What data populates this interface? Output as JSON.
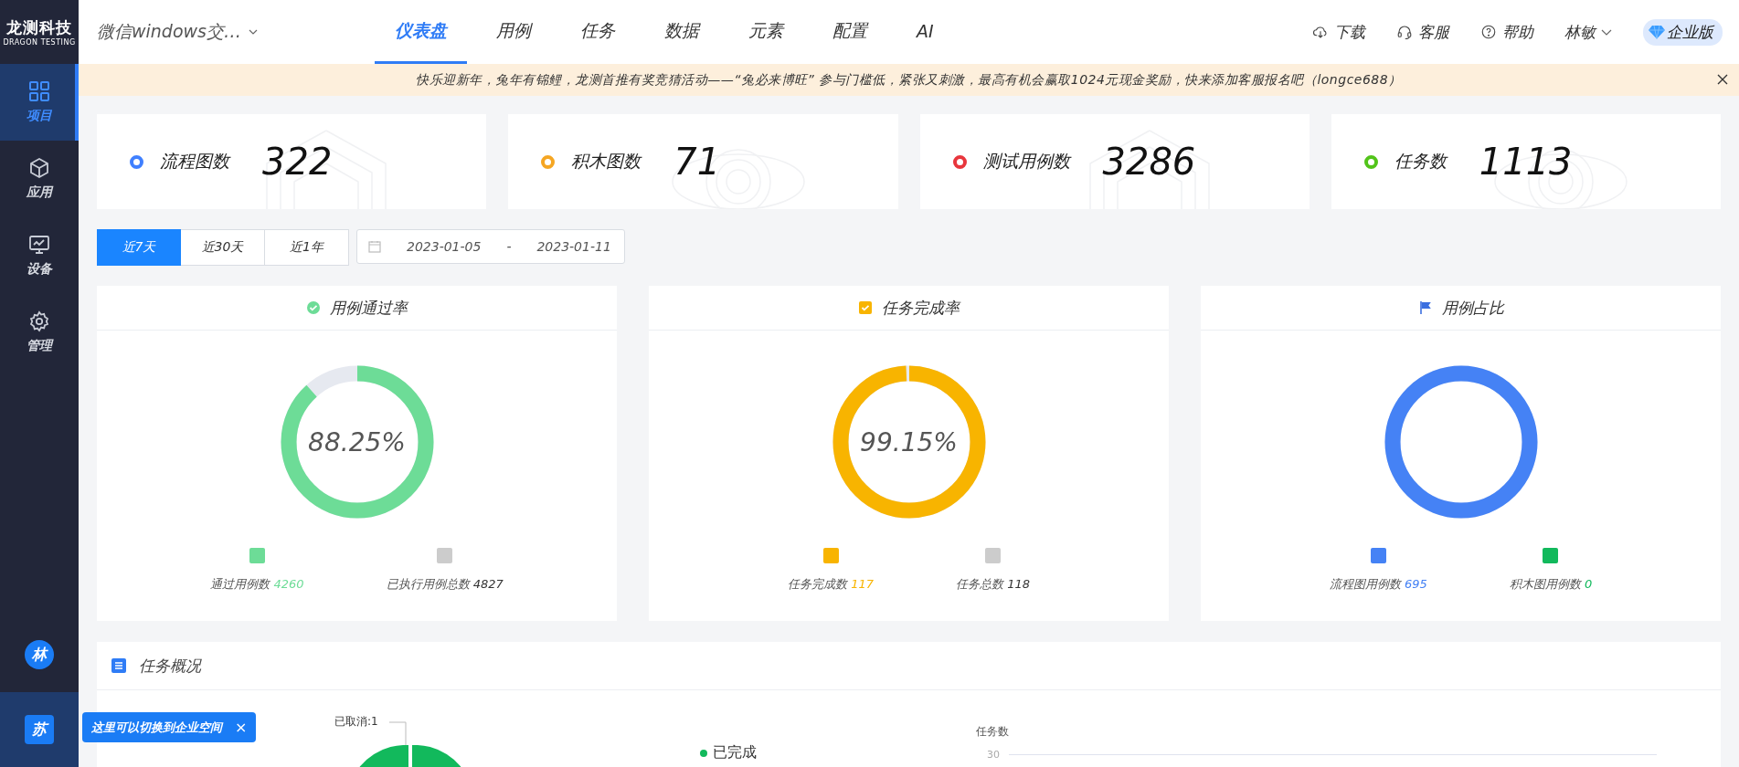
{
  "sidebar": {
    "logo": {
      "title": "龙测科技",
      "subtitle": "DRAGON TESTING"
    },
    "items": [
      {
        "kind": "grid",
        "label": "项目",
        "selected": true
      },
      {
        "kind": "cube",
        "label": "应用",
        "selected": false
      },
      {
        "kind": "monitor",
        "label": "设备",
        "selected": false
      },
      {
        "kind": "gear",
        "label": "管理",
        "selected": false
      }
    ],
    "avatars": [
      {
        "letter": "林",
        "selected": false
      },
      {
        "letter": "苏",
        "selected": true
      }
    ],
    "tooltip": {
      "text": "这里可以切换到企业空间",
      "close": "×"
    }
  },
  "topbar": {
    "project": "微信windows交…",
    "tabs": [
      {
        "label": "仪表盘",
        "selected": true
      },
      {
        "label": "用例",
        "selected": false
      },
      {
        "label": "任务",
        "selected": false
      },
      {
        "label": "数据",
        "selected": false
      },
      {
        "label": "元素",
        "selected": false
      },
      {
        "label": "配置",
        "selected": false
      },
      {
        "label": "AI",
        "selected": false
      }
    ],
    "actions": [
      {
        "kind": "download",
        "label": "下载"
      },
      {
        "kind": "headset",
        "label": "客服"
      },
      {
        "kind": "help",
        "label": "帮助"
      }
    ],
    "user": "林敏",
    "edition": "企业版"
  },
  "banner": {
    "text": "快乐迎新年，兔年有锦鲤，龙测首推有奖竞猜活动——“兔必来博旺” 参与门槛低，紧张又刺激，最高有机会赢取1024元现金奖励，快来添加客服报名吧（longce688）"
  },
  "stats": [
    {
      "label": "流程图数",
      "value": "322",
      "color": "#4080ff"
    },
    {
      "label": "积木图数",
      "value": "71",
      "color": "#f5a623"
    },
    {
      "label": "测试用例数",
      "value": "3286",
      "color": "#e8363d"
    },
    {
      "label": "任务数",
      "value": "1113",
      "color": "#52c41a"
    }
  ],
  "range": {
    "options": [
      {
        "label": "近7天",
        "selected": true
      },
      {
        "label": "近30天",
        "selected": false
      },
      {
        "label": "近1年",
        "selected": false
      }
    ],
    "start": "2023-01-05",
    "separator": "-",
    "end": "2023-01-11"
  },
  "rate_cards": [
    {
      "kind": "check",
      "title": "用例通过率",
      "center": "88.25%",
      "level": 0.8825,
      "color": "#6ddc97",
      "legend": [
        {
          "label": "通过用例数",
          "value": "4260",
          "color": "#6ddc97"
        },
        {
          "label": "已执行用例总数",
          "value": "4827",
          "color": "#cccccc"
        }
      ]
    },
    {
      "kind": "checkbox",
      "title": "任务完成率",
      "center": "99.15%",
      "level": 0.9915,
      "color": "#f8b400",
      "legend": [
        {
          "label": "任务完成数",
          "value": "117",
          "color": "#f8b400"
        },
        {
          "label": "任务总数",
          "value": "118",
          "color": "#cccccc"
        }
      ]
    },
    {
      "kind": "flag",
      "title": "用例占比",
      "level": 1,
      "color": "#4582f5",
      "legend": [
        {
          "label": "流程图用例数",
          "value": "695",
          "color": "#4582f5"
        },
        {
          "label": "积木图用例数",
          "value": "0",
          "color": "#12b95c"
        }
      ]
    }
  ],
  "overview": {
    "title": "任务概况",
    "pie_label": "已取消:1",
    "legend": [
      {
        "label": "已完成",
        "color": "#12b95c"
      }
    ],
    "bar_axis_title": "任务数",
    "bar_tick": "30"
  }
}
